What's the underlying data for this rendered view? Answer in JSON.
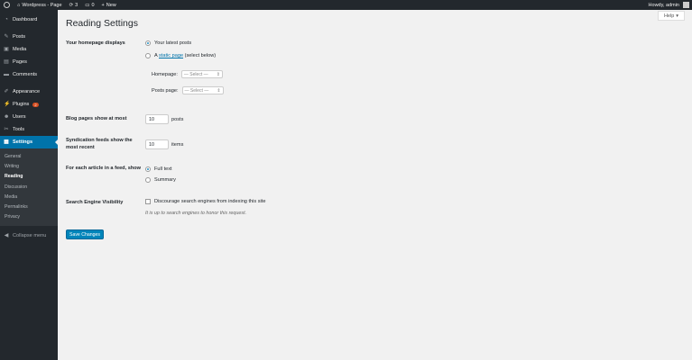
{
  "adminbar": {
    "site_name": "Wordpress - Page",
    "updates_count": "3",
    "comments_count": "0",
    "new_label": "New",
    "howdy": "Howdy, admin"
  },
  "sidebar": {
    "items": [
      {
        "label": "Dashboard",
        "icon": "dashboard-icon"
      },
      {
        "label": "Posts",
        "icon": "pin-icon"
      },
      {
        "label": "Media",
        "icon": "media-icon"
      },
      {
        "label": "Pages",
        "icon": "page-icon"
      },
      {
        "label": "Comments",
        "icon": "comment-icon"
      },
      {
        "label": "Appearance",
        "icon": "brush-icon"
      },
      {
        "label": "Plugins",
        "icon": "plugin-icon",
        "badge": "2"
      },
      {
        "label": "Users",
        "icon": "users-icon"
      },
      {
        "label": "Tools",
        "icon": "wrench-icon"
      },
      {
        "label": "Settings",
        "icon": "settings-icon"
      }
    ],
    "submenu": [
      "General",
      "Writing",
      "Reading",
      "Discussion",
      "Media",
      "Permalinks",
      "Privacy"
    ],
    "collapse_label": "Collapse menu"
  },
  "help_label": "Help",
  "page_title": "Reading Settings",
  "homepage": {
    "label": "Your homepage displays",
    "latest_posts": "Your latest posts",
    "static_prefix": "A",
    "static_link": "static page",
    "static_suffix": "(select below)",
    "homepage_label": "Homepage:",
    "posts_page_label": "Posts page:",
    "select_placeholder": "— Select —"
  },
  "blog_pages": {
    "label": "Blog pages show at most",
    "value": "10",
    "unit": "posts"
  },
  "syndication": {
    "label": "Syndication feeds show the most recent",
    "value": "10",
    "unit": "items"
  },
  "feed_article": {
    "label": "For each article in a feed, show",
    "full_text": "Full text",
    "summary": "Summary"
  },
  "search_visibility": {
    "label": "Search Engine Visibility",
    "checkbox_label": "Discourage search engines from indexing this site",
    "description": "It is up to search engines to honor this request."
  },
  "save_label": "Save Changes",
  "colors": {
    "accent": "#0073aa",
    "button": "#0085ba",
    "sidebar": "#23282d"
  }
}
